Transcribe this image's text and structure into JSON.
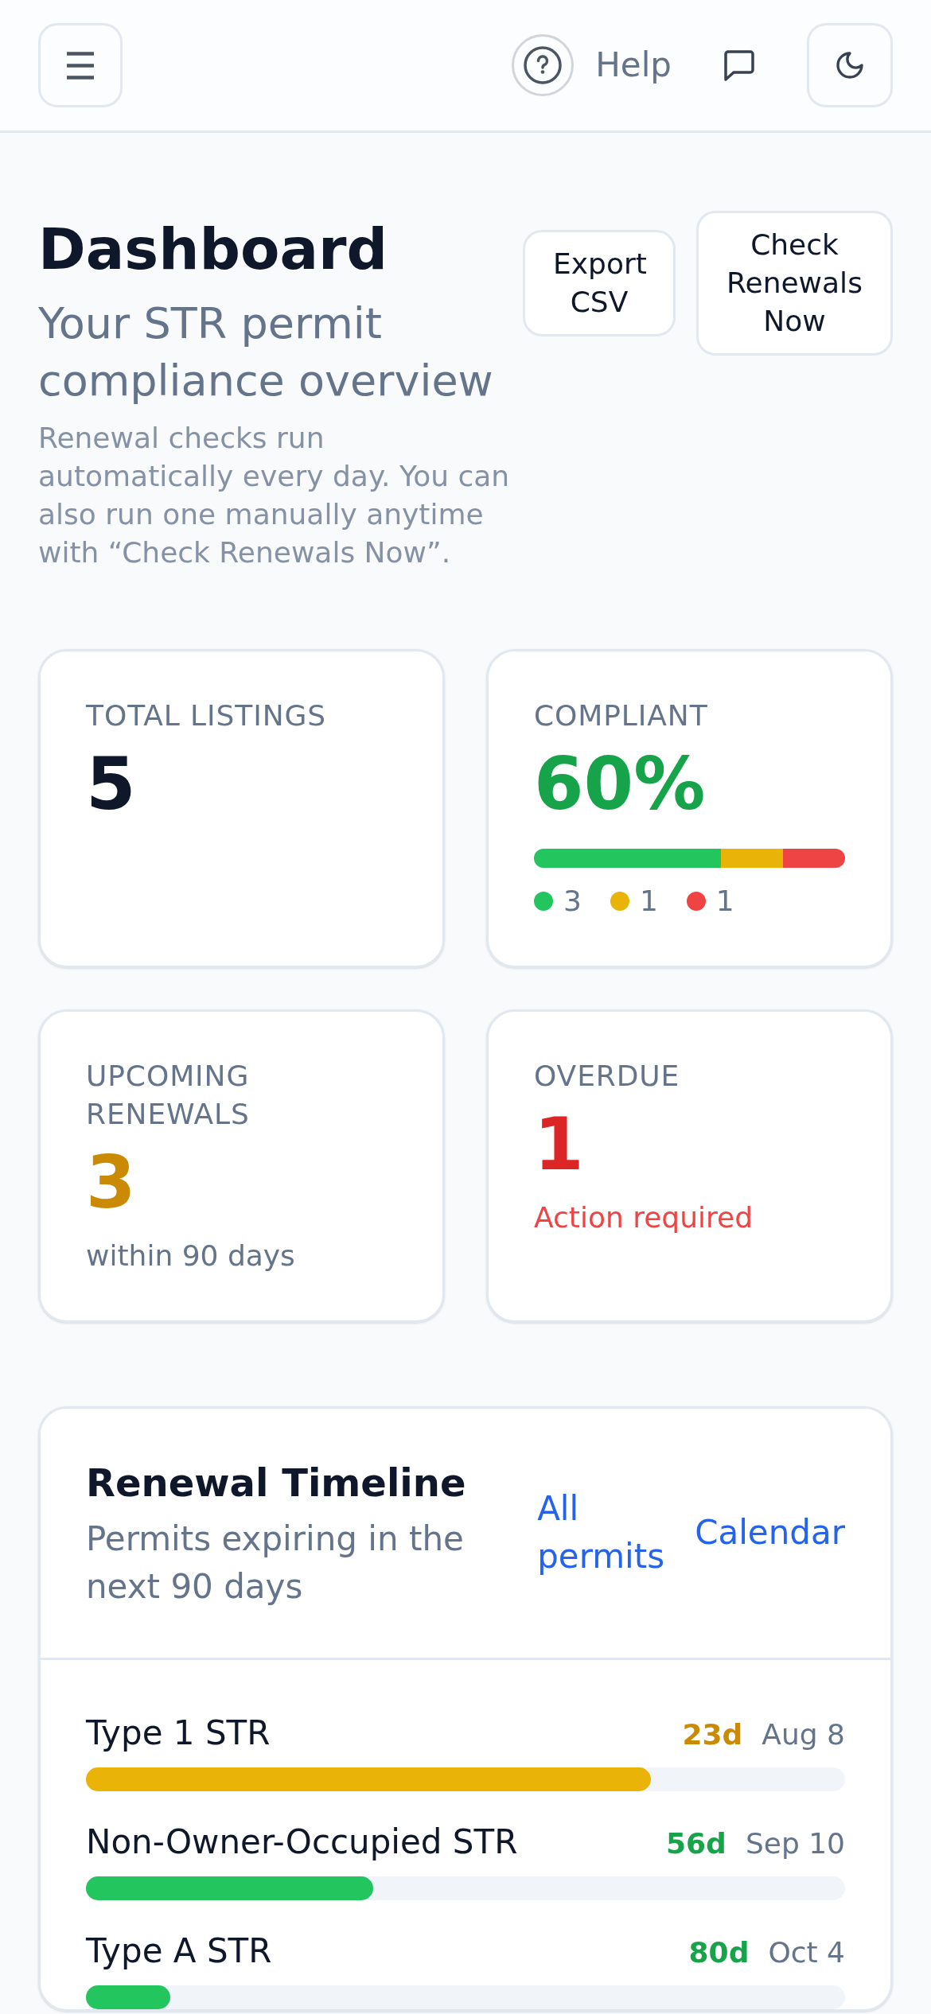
{
  "top_bar": {
    "help_label": "Help"
  },
  "page_header": {
    "title": "Dashboard",
    "subtitle": "Your STR permit compliance overview",
    "note": "Renewal checks run automatically every day. You can also run one manually anytime with “Check Renewals Now”.",
    "actions": [
      {
        "label": "Export CSV"
      },
      {
        "label": "Check Renewals Now"
      }
    ]
  },
  "stats": [
    {
      "label": "TOTAL LISTINGS",
      "value": "5",
      "color": "#0f172a"
    },
    {
      "label": "COMPLIANT",
      "value": "60%",
      "color": "#16a34a",
      "breakdown": [
        {
          "count": "3",
          "color": "#22c55e"
        },
        {
          "count": "1",
          "color": "#eab308"
        },
        {
          "count": "1",
          "color": "#ef4444"
        }
      ]
    },
    {
      "label": "UPCOMING RENEWALS",
      "value": "3",
      "color": "#ca8a04",
      "caption": {
        "text": "within 90 days",
        "alert": false
      }
    },
    {
      "label": "OVERDUE",
      "value": "1",
      "color": "#dc2626",
      "caption": {
        "text": "Action required",
        "alert": true
      }
    }
  ],
  "renewal_timeline": {
    "title": "Renewal Timeline",
    "subtitle": "Permits expiring in the next 90 days",
    "links": [
      "All permits",
      "Calendar"
    ],
    "permits": [
      {
        "name": "Type 1 STR",
        "days_left": "23d",
        "expires": "Aug 8",
        "urgent": true,
        "level": 0.744
      },
      {
        "name": "Non-Owner-Occupied STR",
        "days_left": "56d",
        "expires": "Sep 10",
        "urgent": false,
        "level": 0.378
      },
      {
        "name": "Type A STR",
        "days_left": "80d",
        "expires": "Oct 4",
        "urgent": false,
        "level": 0.111
      }
    ]
  }
}
